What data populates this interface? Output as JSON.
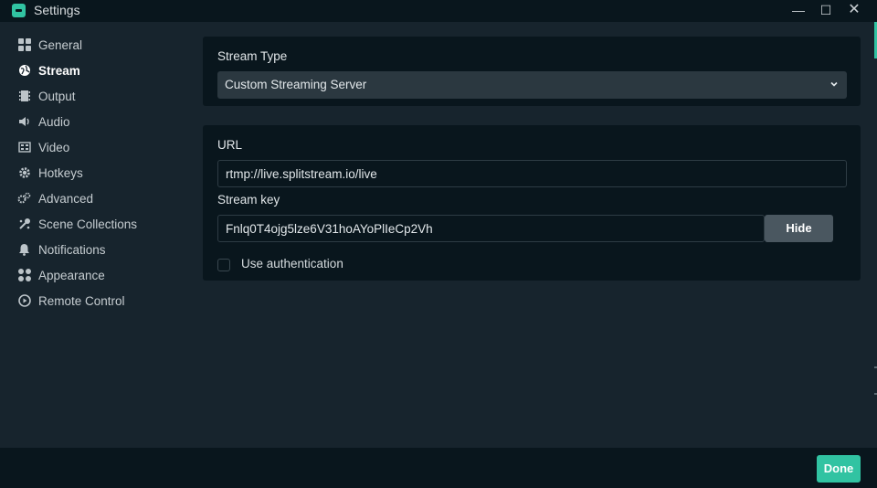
{
  "window": {
    "title": "Settings",
    "minimize_glyph": "—",
    "maximize_glyph": "☐",
    "close_glyph": "✕"
  },
  "sidebar": {
    "items": [
      {
        "label": "General",
        "icon": "grid-icon",
        "active": false
      },
      {
        "label": "Stream",
        "icon": "globe-icon",
        "active": true
      },
      {
        "label": "Output",
        "icon": "film-icon",
        "active": false
      },
      {
        "label": "Audio",
        "icon": "speaker-icon",
        "active": false
      },
      {
        "label": "Video",
        "icon": "video-icon",
        "active": false
      },
      {
        "label": "Hotkeys",
        "icon": "gear-icon",
        "active": false
      },
      {
        "label": "Advanced",
        "icon": "gears-icon",
        "active": false
      },
      {
        "label": "Scene Collections",
        "icon": "collections-icon",
        "active": false
      },
      {
        "label": "Notifications",
        "icon": "bell-icon",
        "active": false
      },
      {
        "label": "Appearance",
        "icon": "palette-icon",
        "active": false
      },
      {
        "label": "Remote Control",
        "icon": "play-circle-icon",
        "active": false
      }
    ]
  },
  "stream_type": {
    "label": "Stream Type",
    "selected": "Custom Streaming Server"
  },
  "server": {
    "url_label": "URL",
    "url_value": "rtmp://live.splitstream.io/live",
    "key_label": "Stream key",
    "key_value": "Fnlq0T4ojg5lze6V31hoAYoPlIeCp2Vh",
    "hide_label": "Hide",
    "auth_label": "Use authentication",
    "auth_checked": false
  },
  "footer": {
    "done_label": "Done"
  },
  "colors": {
    "accent": "#31c3a2",
    "panel": "#09161d",
    "background": "#17242d"
  }
}
